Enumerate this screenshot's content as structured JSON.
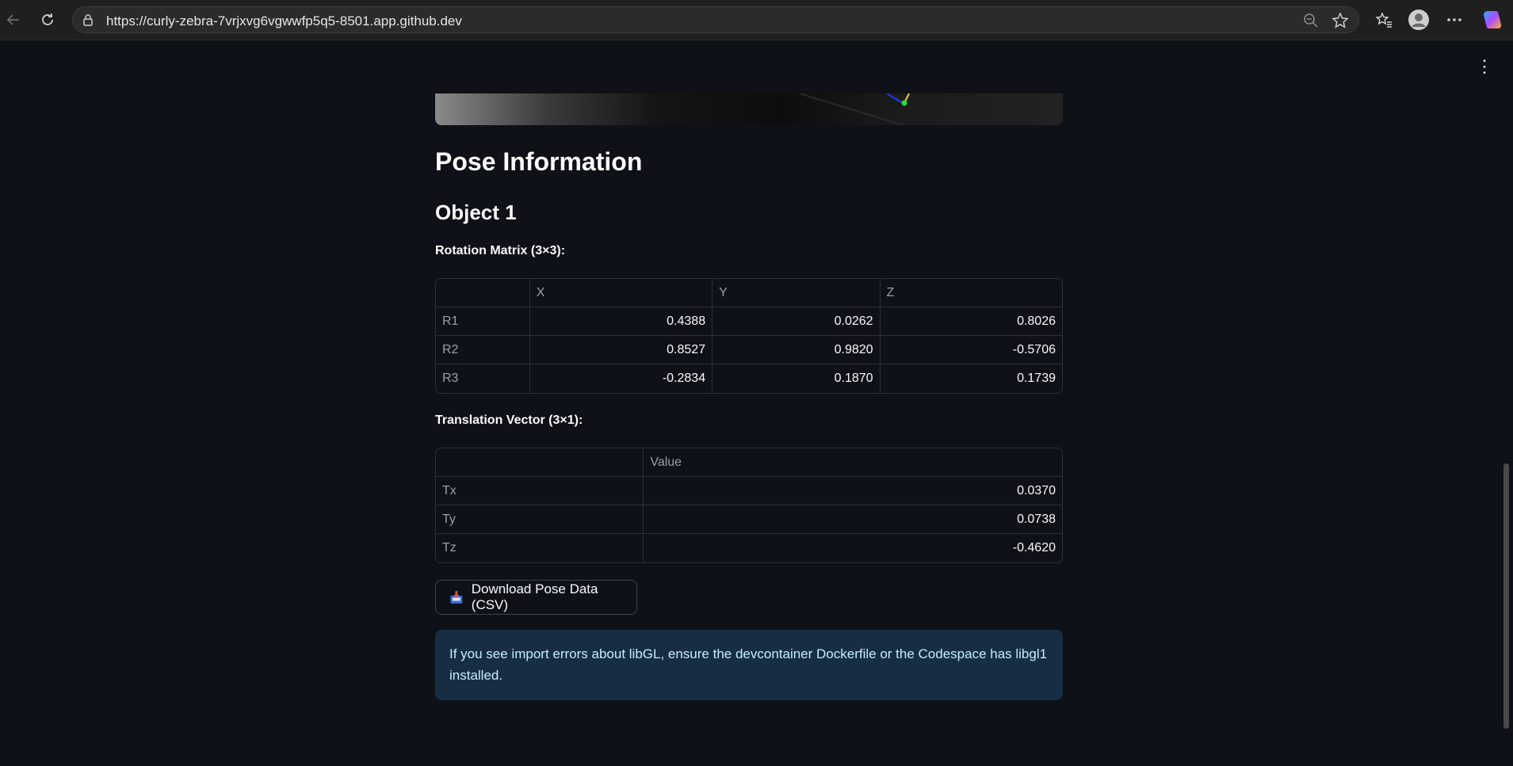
{
  "browser": {
    "url": "https://curly-zebra-7vrjxvg6vgwwfp5q5-8501.app.github.dev"
  },
  "page": {
    "section_title": "Pose Information",
    "object_title": "Object 1",
    "rotation": {
      "label": "Rotation Matrix (3×3):",
      "columns": [
        "",
        "X",
        "Y",
        "Z"
      ],
      "rows": [
        {
          "index": "R1",
          "values": [
            "0.4388",
            "0.0262",
            "0.8026"
          ]
        },
        {
          "index": "R2",
          "values": [
            "0.8527",
            "0.9820",
            "-0.5706"
          ]
        },
        {
          "index": "R3",
          "values": [
            "-0.2834",
            "0.1870",
            "0.1739"
          ]
        }
      ]
    },
    "translation": {
      "label": "Translation Vector (3×1):",
      "columns": [
        "",
        "Value"
      ],
      "rows": [
        {
          "index": "Tx",
          "value": "0.0370"
        },
        {
          "index": "Ty",
          "value": "0.0738"
        },
        {
          "index": "Tz",
          "value": "-0.4620"
        }
      ]
    },
    "download_button": {
      "label": "Download Pose Data (CSV)",
      "icon": "inbox-tray-icon"
    },
    "info_text": "If you see import errors about libGL, ensure the devcontainer Dockerfile or the Codespace has libgl1 installed."
  }
}
